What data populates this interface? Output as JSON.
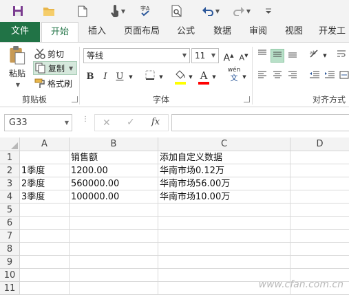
{
  "qat": {
    "icons": [
      "save-icon",
      "open-folder-icon",
      "new-file-icon",
      "touch-mode-icon",
      "spelling-icon",
      "print-preview-icon",
      "undo-icon",
      "redo-icon",
      "customize-icon"
    ]
  },
  "tabs": [
    {
      "label": "文件"
    },
    {
      "label": "开始"
    },
    {
      "label": "插入"
    },
    {
      "label": "页面布局"
    },
    {
      "label": "公式"
    },
    {
      "label": "数据"
    },
    {
      "label": "审阅"
    },
    {
      "label": "视图"
    },
    {
      "label": "开发工"
    }
  ],
  "ribbon": {
    "clipboard": {
      "paste_label": "粘贴",
      "cut_label": "剪切",
      "copy_label": "复制",
      "format_painter_label": "格式刷",
      "group_label": "剪贴板"
    },
    "font": {
      "font_name": "等线",
      "font_size": "11",
      "grow_label": "A",
      "shrink_label": "A",
      "bold_label": "B",
      "italic_label": "I",
      "underline_label": "U",
      "font_color_label": "A",
      "phonetic_label": "wén",
      "phonetic_sub": "文",
      "group_label": "字体",
      "highlight_color": "#ffff00",
      "font_color": "#ff0000"
    },
    "alignment": {
      "group_label": "对齐方式",
      "accent": "#b8e0c8"
    }
  },
  "formula_bar": {
    "name_box": "G33",
    "fx_label": "fx",
    "formula": ""
  },
  "sheet": {
    "columns": [
      "A",
      "B",
      "C",
      "D"
    ],
    "rows": [
      {
        "num": "1",
        "cells": [
          "",
          "销售额",
          "添加自定义数据",
          ""
        ]
      },
      {
        "num": "2",
        "cells": [
          "1季度",
          "1200.00",
          "华南市场0.12万",
          ""
        ]
      },
      {
        "num": "3",
        "cells": [
          "2季度",
          "560000.00",
          "华南市场56.00万",
          ""
        ]
      },
      {
        "num": "4",
        "cells": [
          "3季度",
          "100000.00",
          "华南市场10.00万",
          ""
        ]
      },
      {
        "num": "5",
        "cells": [
          "",
          "",
          "",
          ""
        ]
      },
      {
        "num": "6",
        "cells": [
          "",
          "",
          "",
          ""
        ]
      },
      {
        "num": "7",
        "cells": [
          "",
          "",
          "",
          ""
        ]
      },
      {
        "num": "8",
        "cells": [
          "",
          "",
          "",
          ""
        ]
      },
      {
        "num": "9",
        "cells": [
          "",
          "",
          "",
          ""
        ]
      },
      {
        "num": "10",
        "cells": [
          "",
          "",
          "",
          ""
        ]
      },
      {
        "num": "11",
        "cells": [
          "",
          "",
          "",
          ""
        ]
      }
    ]
  },
  "watermark": "www.cfan.com.cn"
}
